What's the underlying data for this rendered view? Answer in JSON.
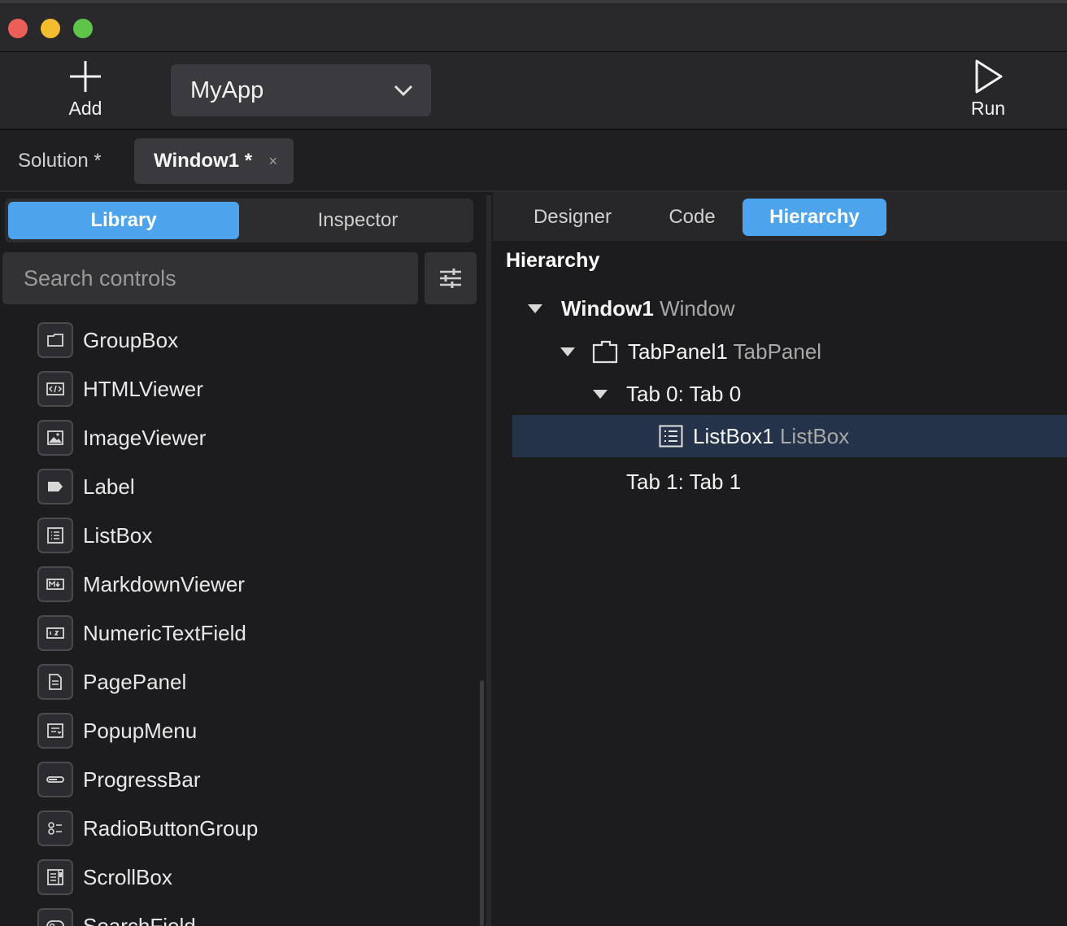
{
  "toolbar": {
    "add_label": "Add",
    "project_name": "MyApp",
    "run_label": "Run"
  },
  "doc_tabs": {
    "solution": "Solution *",
    "window": "Window1 *",
    "close": "×"
  },
  "left_panel": {
    "segments": {
      "library": "Library",
      "inspector": "Inspector"
    },
    "search_placeholder": "Search controls",
    "items": [
      {
        "label": "GroupBox",
        "icon": "groupbox-icon"
      },
      {
        "label": "HTMLViewer",
        "icon": "html-viewer-icon"
      },
      {
        "label": "ImageViewer",
        "icon": "image-viewer-icon"
      },
      {
        "label": "Label",
        "icon": "label-icon"
      },
      {
        "label": "ListBox",
        "icon": "listbox-icon"
      },
      {
        "label": "MarkdownViewer",
        "icon": "markdown-viewer-icon"
      },
      {
        "label": "NumericTextField",
        "icon": "numeric-textfield-icon"
      },
      {
        "label": "PagePanel",
        "icon": "pagepanel-icon"
      },
      {
        "label": "PopupMenu",
        "icon": "popupmenu-icon"
      },
      {
        "label": "ProgressBar",
        "icon": "progressbar-icon"
      },
      {
        "label": "RadioButtonGroup",
        "icon": "radiobuttongroup-icon"
      },
      {
        "label": "ScrollBox",
        "icon": "scrollbox-icon"
      },
      {
        "label": "SearchField",
        "icon": "searchfield-icon"
      }
    ]
  },
  "right_panel": {
    "tabs": {
      "designer": "Designer",
      "code": "Code",
      "hierarchy": "Hierarchy"
    },
    "title": "Hierarchy",
    "tree": {
      "window": {
        "name": "Window1",
        "type": "Window"
      },
      "tabpanel": {
        "name": "TabPanel1",
        "type": "TabPanel"
      },
      "tab0": {
        "label": "Tab 0: Tab 0"
      },
      "listbox": {
        "name": "ListBox1",
        "type": "ListBox"
      },
      "tab1": {
        "label": "Tab 1: Tab 1"
      }
    }
  },
  "colors": {
    "accent": "#4da3ec",
    "selection": "#243349",
    "traffic_close": "#ec5f57",
    "traffic_min": "#f4bd30",
    "traffic_max": "#5fc54a"
  }
}
